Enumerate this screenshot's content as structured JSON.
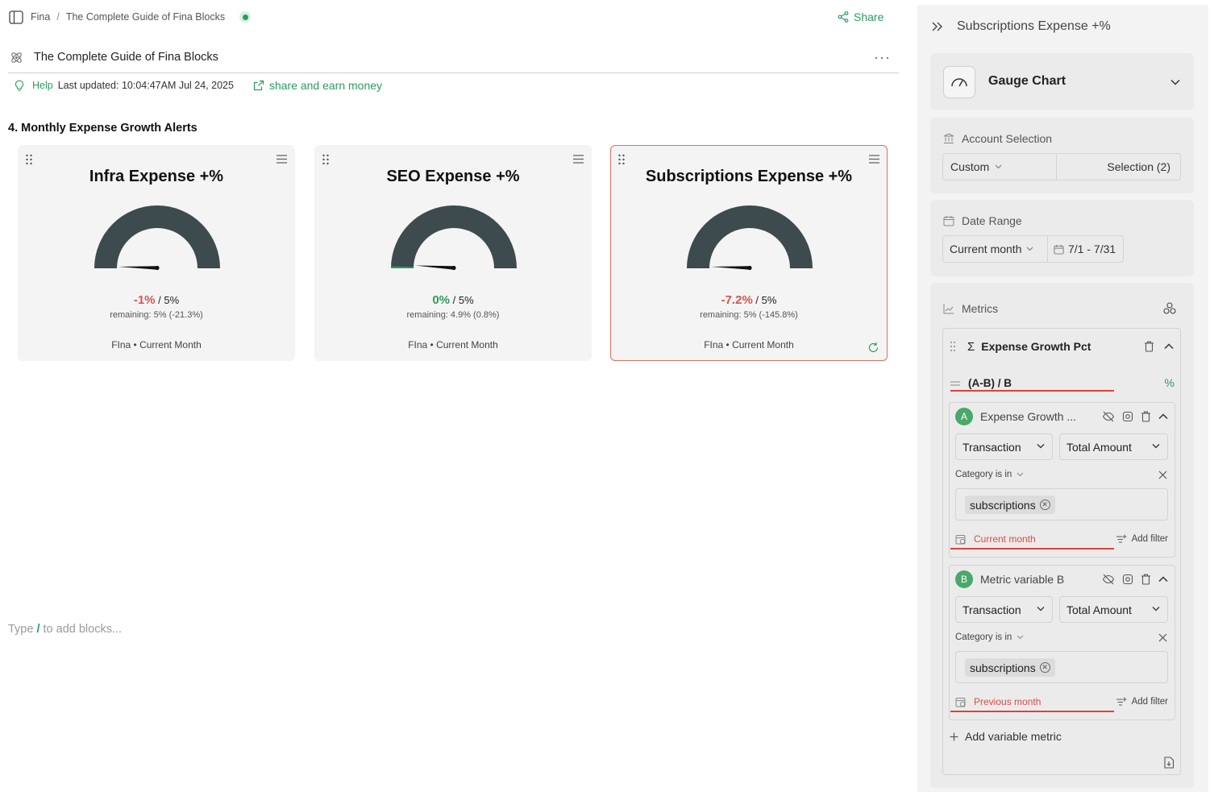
{
  "breadcrumb": {
    "workspace": "Fina",
    "page": "The Complete Guide of Fina Blocks"
  },
  "header": {
    "share_label": "Share",
    "doc_title": "The Complete Guide of Fina Blocks",
    "more_label": "···"
  },
  "meta": {
    "help_label": "Help",
    "last_updated": "Last updated: 10:04:47AM Jul 24, 2025",
    "earn_label": "share and earn money"
  },
  "section": {
    "heading": "4. Monthly Expense Growth Alerts"
  },
  "cards": [
    {
      "title": "Infra Expense +%",
      "value": "-1%",
      "value_sign": "negative",
      "target": " / 5%",
      "remaining": "remaining: 5% (-21.3%)",
      "footer": "FIna • Current Month",
      "gauge_fraction": 0,
      "selected": false
    },
    {
      "title": "SEO Expense +%",
      "value": "0%",
      "value_sign": "positive",
      "target": " / 5%",
      "remaining": "remaining: 4.9% (0.8%)",
      "footer": "FIna • Current Month",
      "gauge_fraction": 0.01,
      "selected": false
    },
    {
      "title": "Subscriptions Expense +%",
      "value": "-7.2%",
      "value_sign": "negative",
      "target": " / 5%",
      "remaining": "remaining: 5% (-145.8%)",
      "footer": "FIna • Current Month",
      "gauge_fraction": 0,
      "selected": true
    }
  ],
  "editor": {
    "add_prefix": "Type ",
    "slash": "/",
    "add_suffix": " to add blocks..."
  },
  "panel": {
    "title": "Subscriptions Expense +%",
    "chart_type": "Gauge Chart",
    "account": {
      "label": "Account Selection",
      "mode": "Custom",
      "selection": "Selection (2)"
    },
    "date_range": {
      "label": "Date Range",
      "mode": "Current month",
      "range": "7/1 - 7/31"
    },
    "metrics": {
      "label": "Metrics",
      "metric_name": "Expense Growth Pct",
      "sigma": "Σ",
      "formula": "(A-B) / B",
      "formula_unit": "%",
      "variables": [
        {
          "badge": "A",
          "name": "Expense Growth ...",
          "source": "Transaction",
          "field": "Total Amount",
          "filter_label": "Category is in",
          "tag": "subscriptions",
          "date": "Current month",
          "add_filter": "Add filter"
        },
        {
          "badge": "B",
          "name": "Metric variable B",
          "source": "Transaction",
          "field": "Total Amount",
          "filter_label": "Category is in",
          "tag": "subscriptions",
          "date": "Previous month",
          "add_filter": "Add filter"
        }
      ],
      "add_variable": "Add variable metric"
    }
  },
  "colors": {
    "accent_green": "#2a9d5c",
    "negative_red": "#d9534f",
    "gauge_fill": "#3d4b4e",
    "selected_border": "#e0705e"
  }
}
